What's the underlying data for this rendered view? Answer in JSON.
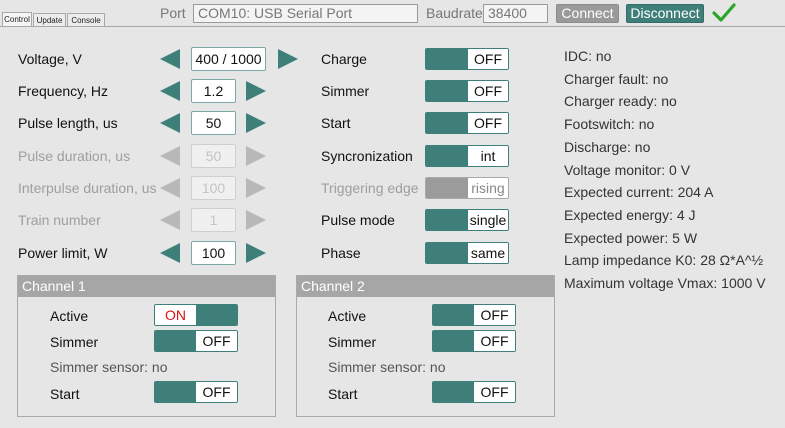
{
  "tabs": [
    "Control",
    "Update",
    "Console"
  ],
  "header": {
    "port_label": "Port",
    "port_value": "COM10: USB Serial Port",
    "baud_label": "Baudrate",
    "baud_value": "38400",
    "connect_label": "Connect",
    "disconnect_label": "Disconnect",
    "connected_icon": "checkmark-icon"
  },
  "params": [
    {
      "label": "Voltage, V",
      "value": "400 / 1000",
      "enabled": true
    },
    {
      "label": "Frequency, Hz",
      "value": "1.2",
      "enabled": true
    },
    {
      "label": "Pulse length, us",
      "value": "50",
      "enabled": true
    },
    {
      "label": "Pulse duration, us",
      "value": "50",
      "enabled": false
    },
    {
      "label": "Interpulse duration, us",
      "value": "100",
      "enabled": false
    },
    {
      "label": "Train number",
      "value": "1",
      "enabled": false
    },
    {
      "label": "Power limit, W",
      "value": "100",
      "enabled": true
    }
  ],
  "modes": [
    {
      "label": "Charge",
      "value": "OFF",
      "enabled": true
    },
    {
      "label": "Simmer",
      "value": "OFF",
      "enabled": true
    },
    {
      "label": "Start",
      "value": "OFF",
      "enabled": true
    },
    {
      "label": "Syncronization",
      "value": "int",
      "enabled": true
    },
    {
      "label": "Triggering edge",
      "value": "rising",
      "enabled": false
    },
    {
      "label": "Pulse mode",
      "value": "single",
      "enabled": true
    },
    {
      "label": "Phase",
      "value": "same",
      "enabled": true
    }
  ],
  "status": [
    "IDC:  no",
    "Charger fault:  no",
    "Charger ready:  no",
    "Footswitch:  no",
    "Discharge:  no",
    "Voltage monitor:  0 V",
    "Expected current:  204 A",
    "Expected energy:  4 J",
    "Expected power:  5 W",
    "Lamp impedance K0:  28 Ω*A^½",
    "Maximum voltage Vmax:  1000 V"
  ],
  "channel1": {
    "title": "Channel 1",
    "active_label": "Active",
    "active_value": "ON",
    "simmer_label": "Simmer",
    "simmer_value": "OFF",
    "sensor_text": "Simmer sensor:  no",
    "start_label": "Start",
    "start_value": "OFF"
  },
  "channel2": {
    "title": "Channel 2",
    "active_label": "Active",
    "active_value": "OFF",
    "simmer_label": "Simmer",
    "simmer_value": "OFF",
    "sensor_text": "Simmer sensor:  no",
    "start_label": "Start",
    "start_value": "OFF"
  },
  "colors": {
    "accent": "#3f7f7a",
    "disabled": "#a8a8a8",
    "on_text": "#dd1111",
    "check": "#2aa52a"
  }
}
